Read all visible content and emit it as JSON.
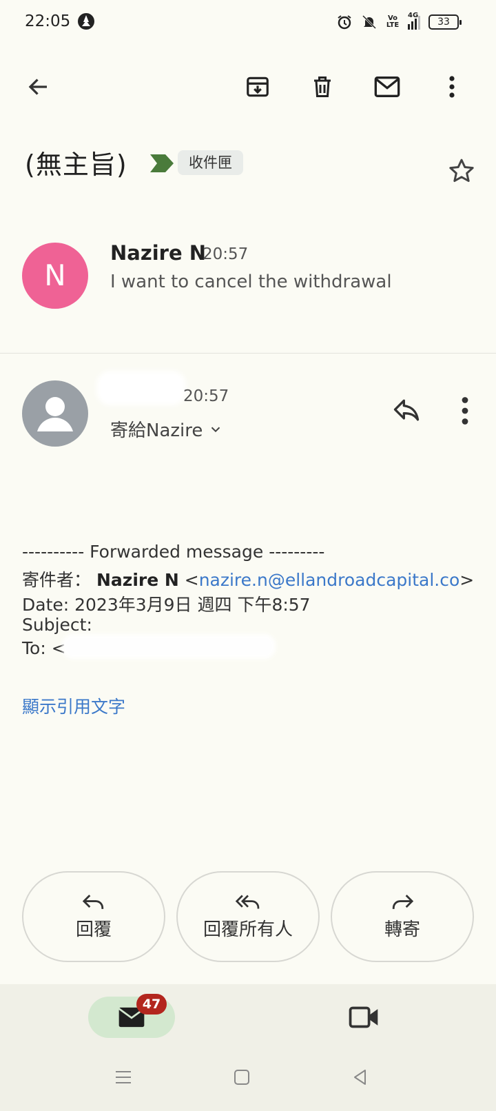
{
  "status_bar": {
    "time": "22:05",
    "network": "4G",
    "volte": "Vo LTE",
    "battery": "33",
    "icons": [
      "alarm-icon",
      "bell-off-icon",
      "volte-icon",
      "signal-icon",
      "battery-icon"
    ]
  },
  "toolbar": {
    "icons": [
      "back-arrow-icon",
      "archive-icon",
      "trash-icon",
      "mail-icon",
      "more-vert-icon"
    ]
  },
  "thread": {
    "subject": "(無主旨)",
    "label": "收件匣",
    "label_color": "#4a7b3b"
  },
  "messages": [
    {
      "avatar_letter": "N",
      "avatar_color": "#ef6295",
      "sender": "Nazire N",
      "time": "20:57",
      "snippet": "I want to cancel the withdrawal"
    },
    {
      "time": "20:57",
      "to_line": "寄給Nazire"
    }
  ],
  "forwarded": {
    "header": "---------- Forwarded message ---------",
    "from_label": "寄件者：",
    "from_name": "Nazire N",
    "from_email": "nazire.n@ellandroadcapital.co",
    "date_line": "Date: 2023年3月9日 週四 下午8:57",
    "subject_line": "Subject:",
    "to_label": "To: <",
    "show_quoted": "顯示引用文字"
  },
  "actions": {
    "reply": "回覆",
    "reply_all": "回覆所有人",
    "forward": "轉寄"
  },
  "bottom_nav": {
    "mail_badge": "47",
    "accent_color": "#d3e8cf",
    "badge_color": "#b3261e"
  }
}
